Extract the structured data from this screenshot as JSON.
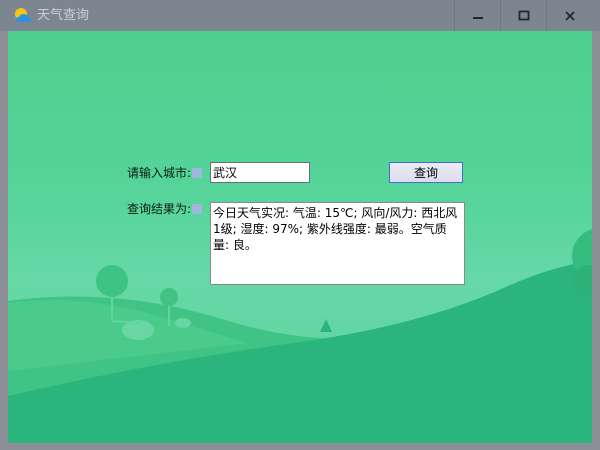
{
  "window": {
    "title": "天气查询",
    "icon": "weather-app-icon",
    "controls": {
      "minimize": "minimize-icon",
      "maximize": "maximize-icon",
      "close": "close-icon"
    }
  },
  "form": {
    "city_label": "请输入城市:",
    "city_value": "武汉",
    "query_button": "查询",
    "result_label": "查询结果为:",
    "result_text": "今日天气实况: 气温: 15℃; 风向/风力: 西北风 1级; 湿度: 97%; 紫外线强度: 最弱。空气质量: 良。"
  },
  "colors": {
    "background_green": "#56d49a",
    "hill_dark_green": "#2bb57c",
    "titlebar": "#7c8691",
    "button_border": "#3f6fd4"
  }
}
